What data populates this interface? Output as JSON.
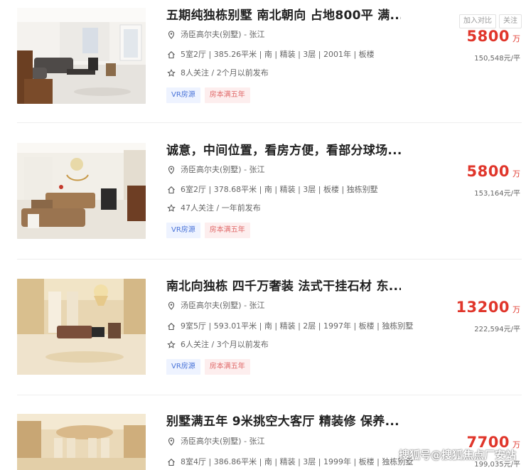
{
  "actions": {
    "compare_label": "加入对比",
    "follow_label": "关注"
  },
  "listings": [
    {
      "title": "五期纯独栋别墅 南北朝向 占地800平 满...",
      "community": "汤臣高尔夫(别墅) - 张江",
      "details": "5室2厅 | 385.26平米 | 南 | 精装 | 3层 | 2001年 | 板楼",
      "follow_info": "8人关注 / 2个月以前发布",
      "tags": [
        "VR房源",
        "房本满五年"
      ],
      "price": "5800",
      "price_unit": "万",
      "unit_price": "150,548元/平"
    },
    {
      "title": "诚意，中间位置，看房方便，看部分球场...",
      "community": "汤臣高尔夫(别墅) - 张江",
      "details": "6室2厅 | 378.68平米 | 南 | 精装 | 3层 | 板楼 | 独栋别墅",
      "follow_info": "47人关注 / 一年前发布",
      "tags": [
        "VR房源",
        "房本满五年"
      ],
      "price": "5800",
      "price_unit": "万",
      "unit_price": "153,164元/平"
    },
    {
      "title": "南北向独栋 四千万奢装 法式干挂石材 东...",
      "community": "汤臣高尔夫(别墅) - 张江",
      "details": "9室5厅 | 593.01平米 | 南 | 精装 | 2层 | 1997年 | 板楼 | 独栋别墅",
      "follow_info": "6人关注 / 3个月以前发布",
      "tags": [
        "VR房源",
        "房本满五年"
      ],
      "price": "13200",
      "price_unit": "万",
      "unit_price": "222,594元/平"
    },
    {
      "title": "别墅满五年 9米挑空大客厅 精装修 保养...",
      "community": "汤臣高尔夫(别墅) - 张江",
      "details": "8室4厅 | 386.86平米 | 南 | 精装 | 3层 | 1999年 | 板楼 | 独栋别墅",
      "price": "7700",
      "price_unit": "万",
      "unit_price": "199,035元/平"
    }
  ],
  "watermark": "搜狐号@搜狐焦点厂安站",
  "colors": {
    "price": "#e0362b",
    "vr_tag": "#4a74d8",
    "five_year_tag": "#e06a6a"
  },
  "icons": [
    "location-pin-icon",
    "house-icon",
    "star-icon"
  ]
}
